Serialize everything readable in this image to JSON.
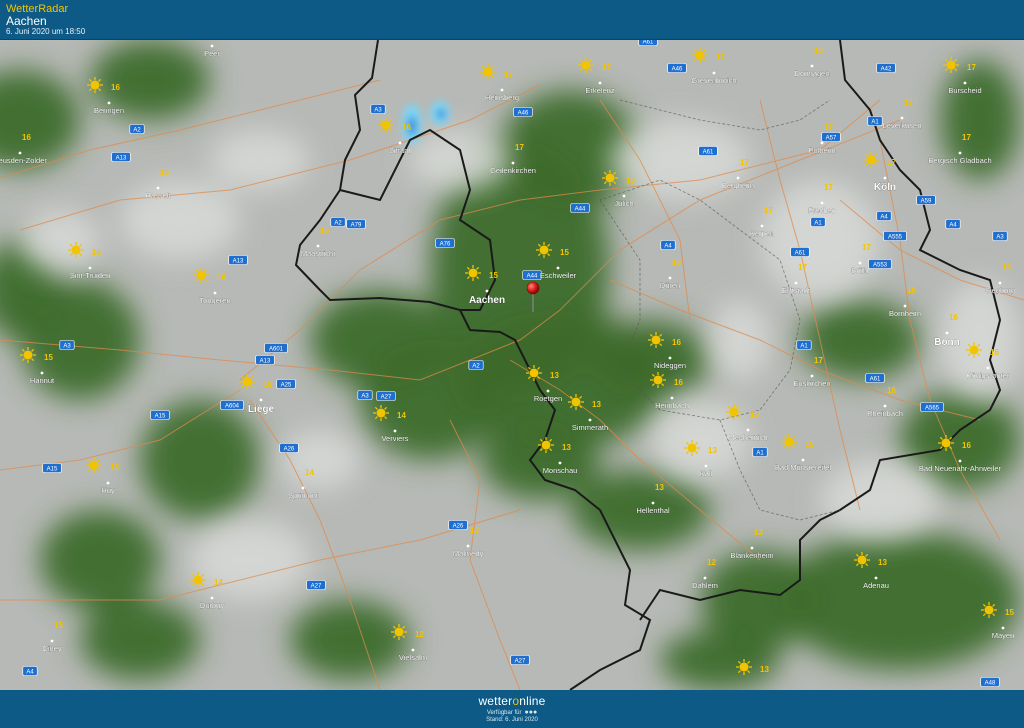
{
  "header": {
    "brand": "WetterRadar",
    "city": "Aachen",
    "timestamp": "6. Juni 2020 um 18:50"
  },
  "footer": {
    "logo_a": "wetter",
    "logo_o": "o",
    "logo_b": "nline",
    "available_label": "Verfügbar für",
    "status_label": "Stand: 6. Juni 2020"
  },
  "places": [
    {
      "name": "Aachen",
      "temp": "15",
      "icon": "sun-icon",
      "major": true
    },
    {
      "name": "Eschweiler",
      "temp": "15",
      "icon": "sun-icon"
    },
    {
      "name": "Düren",
      "temp": "16",
      "icon": "none"
    },
    {
      "name": "Jülich",
      "temp": "16",
      "icon": "sun-icon"
    },
    {
      "name": "Geilenkirchen",
      "temp": "17",
      "icon": "none"
    },
    {
      "name": "Heinsberg",
      "temp": "17",
      "icon": "sun-icon"
    },
    {
      "name": "Sittard",
      "temp": "16",
      "icon": "sun-icon"
    },
    {
      "name": "Erkelenz",
      "temp": "17",
      "icon": "sun-icon"
    },
    {
      "name": "Grevenbroich",
      "temp": "17",
      "icon": "sun-icon"
    },
    {
      "name": "Dormagen",
      "temp": "16",
      "icon": "none"
    },
    {
      "name": "Burscheid",
      "temp": "17",
      "icon": "sun-icon"
    },
    {
      "name": "Leverkusen",
      "temp": "17",
      "icon": "none"
    },
    {
      "name": "Pulheim",
      "temp": "17",
      "icon": "none"
    },
    {
      "name": "Bergisch Gladbach",
      "temp": "17",
      "icon": "none"
    },
    {
      "name": "Köln",
      "temp": "17",
      "icon": "sun-icon",
      "major": true
    },
    {
      "name": "Bergheim",
      "temp": "17",
      "icon": "none"
    },
    {
      "name": "Frechen",
      "temp": "17",
      "icon": "none"
    },
    {
      "name": "Kerpen",
      "temp": "17",
      "icon": "none"
    },
    {
      "name": "Brühl",
      "temp": "17",
      "icon": "none"
    },
    {
      "name": "Erftstadt",
      "temp": "17",
      "icon": "none"
    },
    {
      "name": "Siegburg",
      "temp": "16",
      "icon": "none"
    },
    {
      "name": "Bornheim",
      "temp": "16",
      "icon": "none"
    },
    {
      "name": "Bonn",
      "temp": "16",
      "icon": "none",
      "major": true
    },
    {
      "name": "Königswinter",
      "temp": "16",
      "icon": "sun-icon"
    },
    {
      "name": "Euskirchen",
      "temp": "17",
      "icon": "none"
    },
    {
      "name": "Rheinbach",
      "temp": "16",
      "icon": "none"
    },
    {
      "name": "Bad Neuenahr-Ahrweiler",
      "temp": "16",
      "icon": "sun-icon"
    },
    {
      "name": "Bad Münstereifel",
      "temp": "15",
      "icon": "sun-icon"
    },
    {
      "name": "Mechernich",
      "temp": "15",
      "icon": "sun-icon"
    },
    {
      "name": "Nideggen",
      "temp": "16",
      "icon": "sun-icon"
    },
    {
      "name": "Heimbach",
      "temp": "16",
      "icon": "sun-icon"
    },
    {
      "name": "Simmerath",
      "temp": "13",
      "icon": "sun-icon"
    },
    {
      "name": "Roetgen",
      "temp": "13",
      "icon": "sun-icon"
    },
    {
      "name": "Monschau",
      "temp": "13",
      "icon": "sun-icon"
    },
    {
      "name": "Kall",
      "temp": "13",
      "icon": "sun-icon"
    },
    {
      "name": "Hellenthal",
      "temp": "13",
      "icon": "none"
    },
    {
      "name": "Blankenheim",
      "temp": "13",
      "icon": "none"
    },
    {
      "name": "Dahlem",
      "temp": "12",
      "icon": "none"
    },
    {
      "name": "Adenau",
      "temp": "13",
      "icon": "sun-icon"
    },
    {
      "name": "Mayen",
      "temp": "15",
      "icon": "sun-icon"
    },
    {
      "name": "Maastricht",
      "temp": "16",
      "icon": "none"
    },
    {
      "name": "Tongeren",
      "temp": "16",
      "icon": "sun-icon"
    },
    {
      "name": "Sint-Truiden",
      "temp": "16",
      "icon": "sun-icon"
    },
    {
      "name": "Hasselt",
      "temp": "16",
      "icon": "none"
    },
    {
      "name": "Beringen",
      "temp": "16",
      "icon": "sun-icon"
    },
    {
      "name": "Peer",
      "temp": "",
      "icon": "none"
    },
    {
      "name": "Heusden-Zolder",
      "temp": "16",
      "icon": "none"
    },
    {
      "name": "Liège",
      "temp": "16",
      "icon": "sun-icon",
      "major": true
    },
    {
      "name": "Hannut",
      "temp": "15",
      "icon": "sun-icon"
    },
    {
      "name": "Huy",
      "temp": "15",
      "icon": "sun-icon"
    },
    {
      "name": "Verviers",
      "temp": "14",
      "icon": "sun-icon"
    },
    {
      "name": "Sprimont",
      "temp": "14",
      "icon": "none"
    },
    {
      "name": "Malmedy",
      "temp": "13",
      "icon": "none"
    },
    {
      "name": "Durbuy",
      "temp": "14",
      "icon": "sun-icon"
    },
    {
      "name": "Ciney",
      "temp": "15",
      "icon": "none"
    },
    {
      "name": "Vielsalm",
      "temp": "12",
      "icon": "sun-icon"
    },
    {
      "name": "",
      "temp": "13",
      "icon": "sun-icon"
    }
  ],
  "roads": [
    "A61",
    "A46",
    "A42",
    "A3",
    "A2",
    "A13",
    "A46",
    "A1",
    "A57",
    "A61",
    "A44",
    "A2",
    "A79",
    "A76",
    "A4",
    "A59",
    "A555",
    "A4",
    "A3",
    "A61",
    "A553",
    "A4",
    "A1",
    "A13",
    "A44",
    "A3",
    "A601",
    "A13",
    "A25",
    "A604",
    "A3",
    "A27",
    "A2",
    "A1",
    "A61",
    "A565",
    "A15",
    "A26",
    "A15",
    "A27",
    "A26",
    "A4",
    "A27",
    "A1",
    "A48"
  ],
  "marker": {
    "name": "location-pin-icon",
    "color": "#e0201c"
  },
  "colors": {
    "header": "#0e5a86",
    "accent": "#f2c400",
    "forest": "#3d6b2a",
    "border": "#1a1a1a",
    "road": "#e08a4a",
    "radar": "#79d0f0"
  }
}
